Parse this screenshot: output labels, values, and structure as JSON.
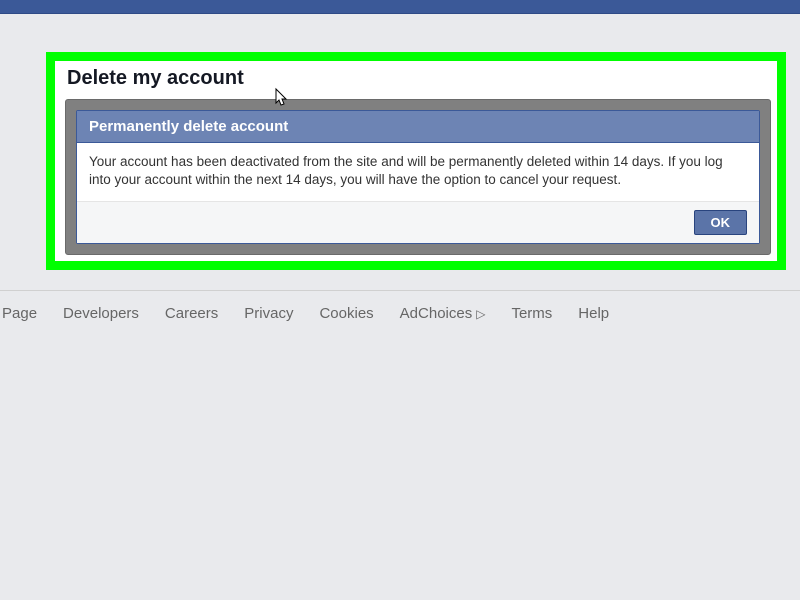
{
  "page": {
    "title": "Delete my account"
  },
  "modal": {
    "header": "Permanently delete account",
    "body": "Your account has been deactivated from the site and will be permanently deleted within 14 days. If you log into your account within the next 14 days, you will have the option to cancel your request.",
    "ok_label": "OK"
  },
  "footer": {
    "links": {
      "page": "Page",
      "developers": "Developers",
      "careers": "Careers",
      "privacy": "Privacy",
      "cookies": "Cookies",
      "adchoices": "AdChoices",
      "terms": "Terms",
      "help": "Help"
    }
  }
}
